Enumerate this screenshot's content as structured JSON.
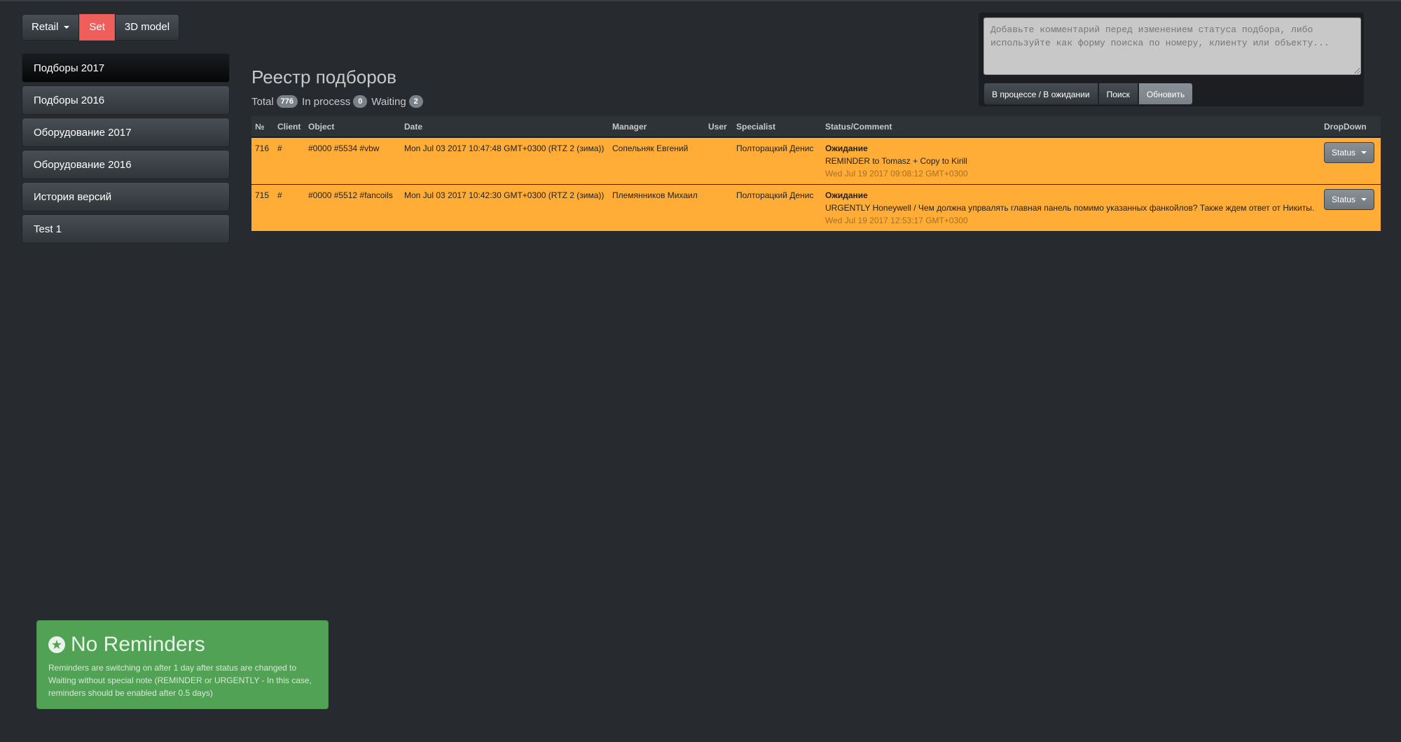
{
  "toolbar": {
    "retail_label": "Retail",
    "set_label": "Set",
    "model_label": "3D model"
  },
  "sidebar": {
    "items": [
      {
        "label": "Подборы 2017"
      },
      {
        "label": "Подборы 2016"
      },
      {
        "label": "Оборудование 2017"
      },
      {
        "label": "Оборудование 2016"
      },
      {
        "label": "История версий"
      },
      {
        "label": "Test 1"
      }
    ]
  },
  "main": {
    "title": "Реестр подборов",
    "counts": {
      "total_label": "Total",
      "total": "776",
      "in_process_label": "In process",
      "in_process": "0",
      "waiting_label": "Waiting",
      "waiting": "2"
    }
  },
  "table": {
    "headers": [
      "№",
      "Client",
      "Object",
      "Date",
      "Manager",
      "User",
      "Specialist",
      "Status/Comment",
      "DropDown"
    ],
    "rows": [
      {
        "num": "716",
        "client": "#",
        "object": "#0000 #5534 #vbw",
        "date": "Mon Jul 03 2017 10:47:48 GMT+0300 (RTZ 2 (зима))",
        "manager": "Сопельняк Евгений",
        "user": "",
        "specialist": "Полторацкий Денис",
        "status": "Ожидание",
        "comment": "REMINDER to Tomasz + Copy to Kirill",
        "comment_date": "Wed Jul 19 2017 09:08:12 GMT+0300",
        "dropdown_label": "Status"
      },
      {
        "num": "715",
        "client": "#",
        "object": "#0000 #5512 #fancoils",
        "date": "Mon Jul 03 2017 10:42:30 GMT+0300 (RTZ 2 (зима))",
        "manager": "Племянников Михаил",
        "user": "",
        "specialist": "Полторацкий Денис",
        "status": "Ожидание",
        "comment": "URGENTLY Honeywell / Чем должна упрвалять главная панель помимо указанных фанкойлов? Также ждем ответ от Никиты.",
        "comment_date": "Wed Jul 19 2017 12:53:17 GMT+0300",
        "dropdown_label": "Status"
      }
    ],
    "row_color": "#ffad37"
  },
  "search": {
    "placeholder": "Добавьте комментарий перед изменением статуса подбора, либо используйте как форму поиска по номеру, клиенту или объекту...",
    "buttons": [
      "В процессе / В ожидании",
      "Поиск",
      "Обновить"
    ]
  },
  "reminders": {
    "icon": "star-circle-icon",
    "title": "No Reminders",
    "text": "Reminders are switching on after 1 day after status are changed to Waiting without special note (REMINDER or URGENTLY - In this case, reminders should be enabled after 0.5 days)"
  },
  "colors": {
    "background": "#272b30",
    "accent_red": "#ee5f5b",
    "row_orange": "#ffad37",
    "success_green": "#52a256"
  }
}
